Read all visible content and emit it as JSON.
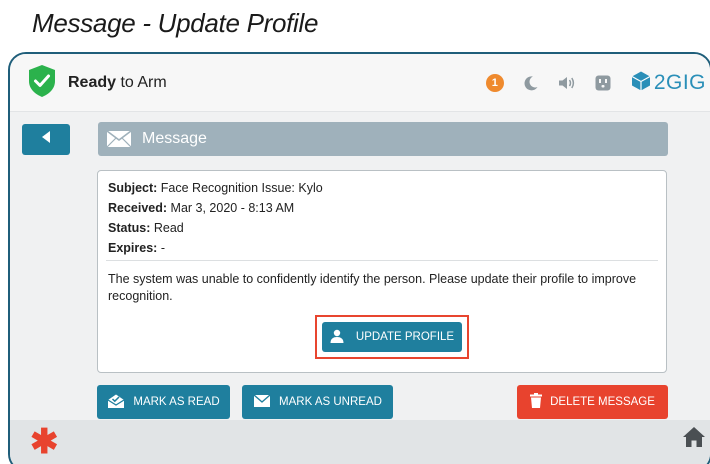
{
  "caption": "Message - Update Profile",
  "status_bar": {
    "ready_bold": "Ready",
    "ready_rest": " to Arm",
    "notification_count": "1",
    "brand": "2GIG",
    "icons": [
      "moon-icon",
      "speaker-icon",
      "outlet-icon"
    ]
  },
  "header": {
    "title": "Message"
  },
  "message": {
    "subject_label": "Subject:",
    "subject_value": " Face Recognition Issue: Kylo",
    "received_label": "Received:",
    "received_value": "  Mar 3, 2020 - 8:13 AM",
    "status_label": "Status:",
    "status_value": " Read",
    "expires_label": "Expires:",
    "expires_value": " -",
    "body": "The system was unable to confidently identify the person. Please update their profile to improve recognition."
  },
  "buttons": {
    "update_profile": "UPDATE PROFILE",
    "mark_as_read": "MARK AS READ",
    "mark_as_unread": "MARK AS UNREAD",
    "delete_message": "DELETE MESSAGE"
  },
  "colors": {
    "accent": "#1f7f9e",
    "danger": "#e8432e",
    "header_bar": "#9fb1bb",
    "ready_green": "#2bb24c",
    "badge_orange": "#ef8a2e"
  }
}
